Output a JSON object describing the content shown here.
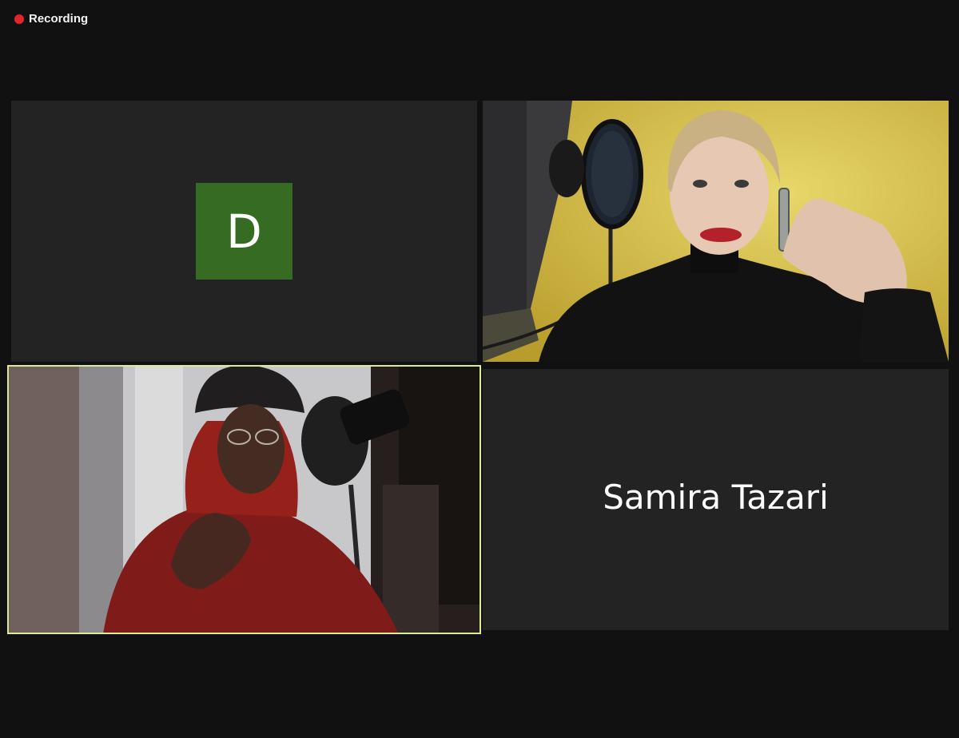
{
  "status": {
    "recording_label": "Recording",
    "recording_color": "#e0262b"
  },
  "participants": [
    {
      "kind": "avatar",
      "initial": "D",
      "avatar_color": "#356b22"
    },
    {
      "kind": "video",
      "video": "woman-video-feed"
    },
    {
      "kind": "video",
      "video": "man-video-feed",
      "active_speaker": true,
      "highlight_color": "#d9ef8f"
    },
    {
      "kind": "name",
      "name": "Samira Tazari"
    }
  ],
  "colors": {
    "background": "#111111",
    "tile": "#232323"
  }
}
